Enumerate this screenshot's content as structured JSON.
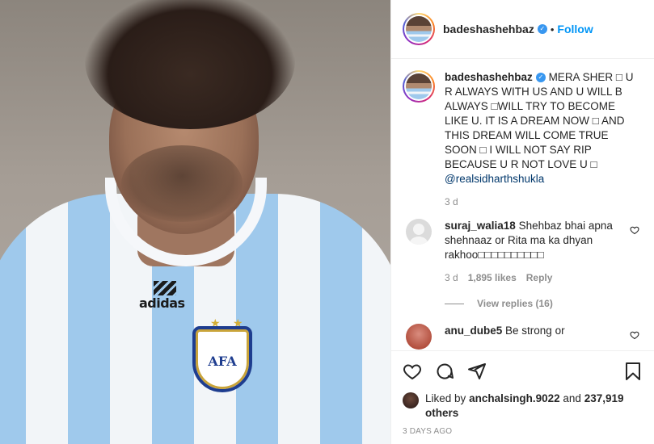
{
  "post": {
    "author": "badeshashehbaz",
    "follow_label": "Follow",
    "separator": "•",
    "caption": "MERA SHER □ U R ALWAYS WITH US AND U WILL B ALWAYS □WILL TRY TO BECOME LIKE U. IT IS A DREAM NOW □ AND THIS DREAM WILL COME TRUE SOON □ I WILL NOT SAY RIP BECAUSE U R NOT LOVE U □",
    "mention": "@realsidharthshukla",
    "caption_time": "3 d",
    "image_text": {
      "brand": "adidas",
      "crest": "AFA"
    }
  },
  "comments": [
    {
      "username": "suraj_walia18",
      "text": "Shehbaz bhai apna shehnaaz or Rita ma ka dhyan rakhoo□□□□□□□□□□",
      "time": "3 d",
      "likes": "1,895 likes",
      "reply_label": "Reply",
      "view_replies": "View replies (16)"
    },
    {
      "username": "anu_dube5",
      "text": "Be strong or"
    }
  ],
  "likes": {
    "prefix": "Liked by",
    "user": "anchalsingh.9022",
    "and": "and",
    "count": "237,919 others"
  },
  "posted": "3 DAYS AGO",
  "colors": {
    "accent": "#0095f6",
    "verified": "#3897f0",
    "muted": "#8e8e8e"
  },
  "icons": [
    "heart-icon",
    "comment-icon",
    "share-icon",
    "bookmark-icon",
    "verified-badge-icon"
  ]
}
